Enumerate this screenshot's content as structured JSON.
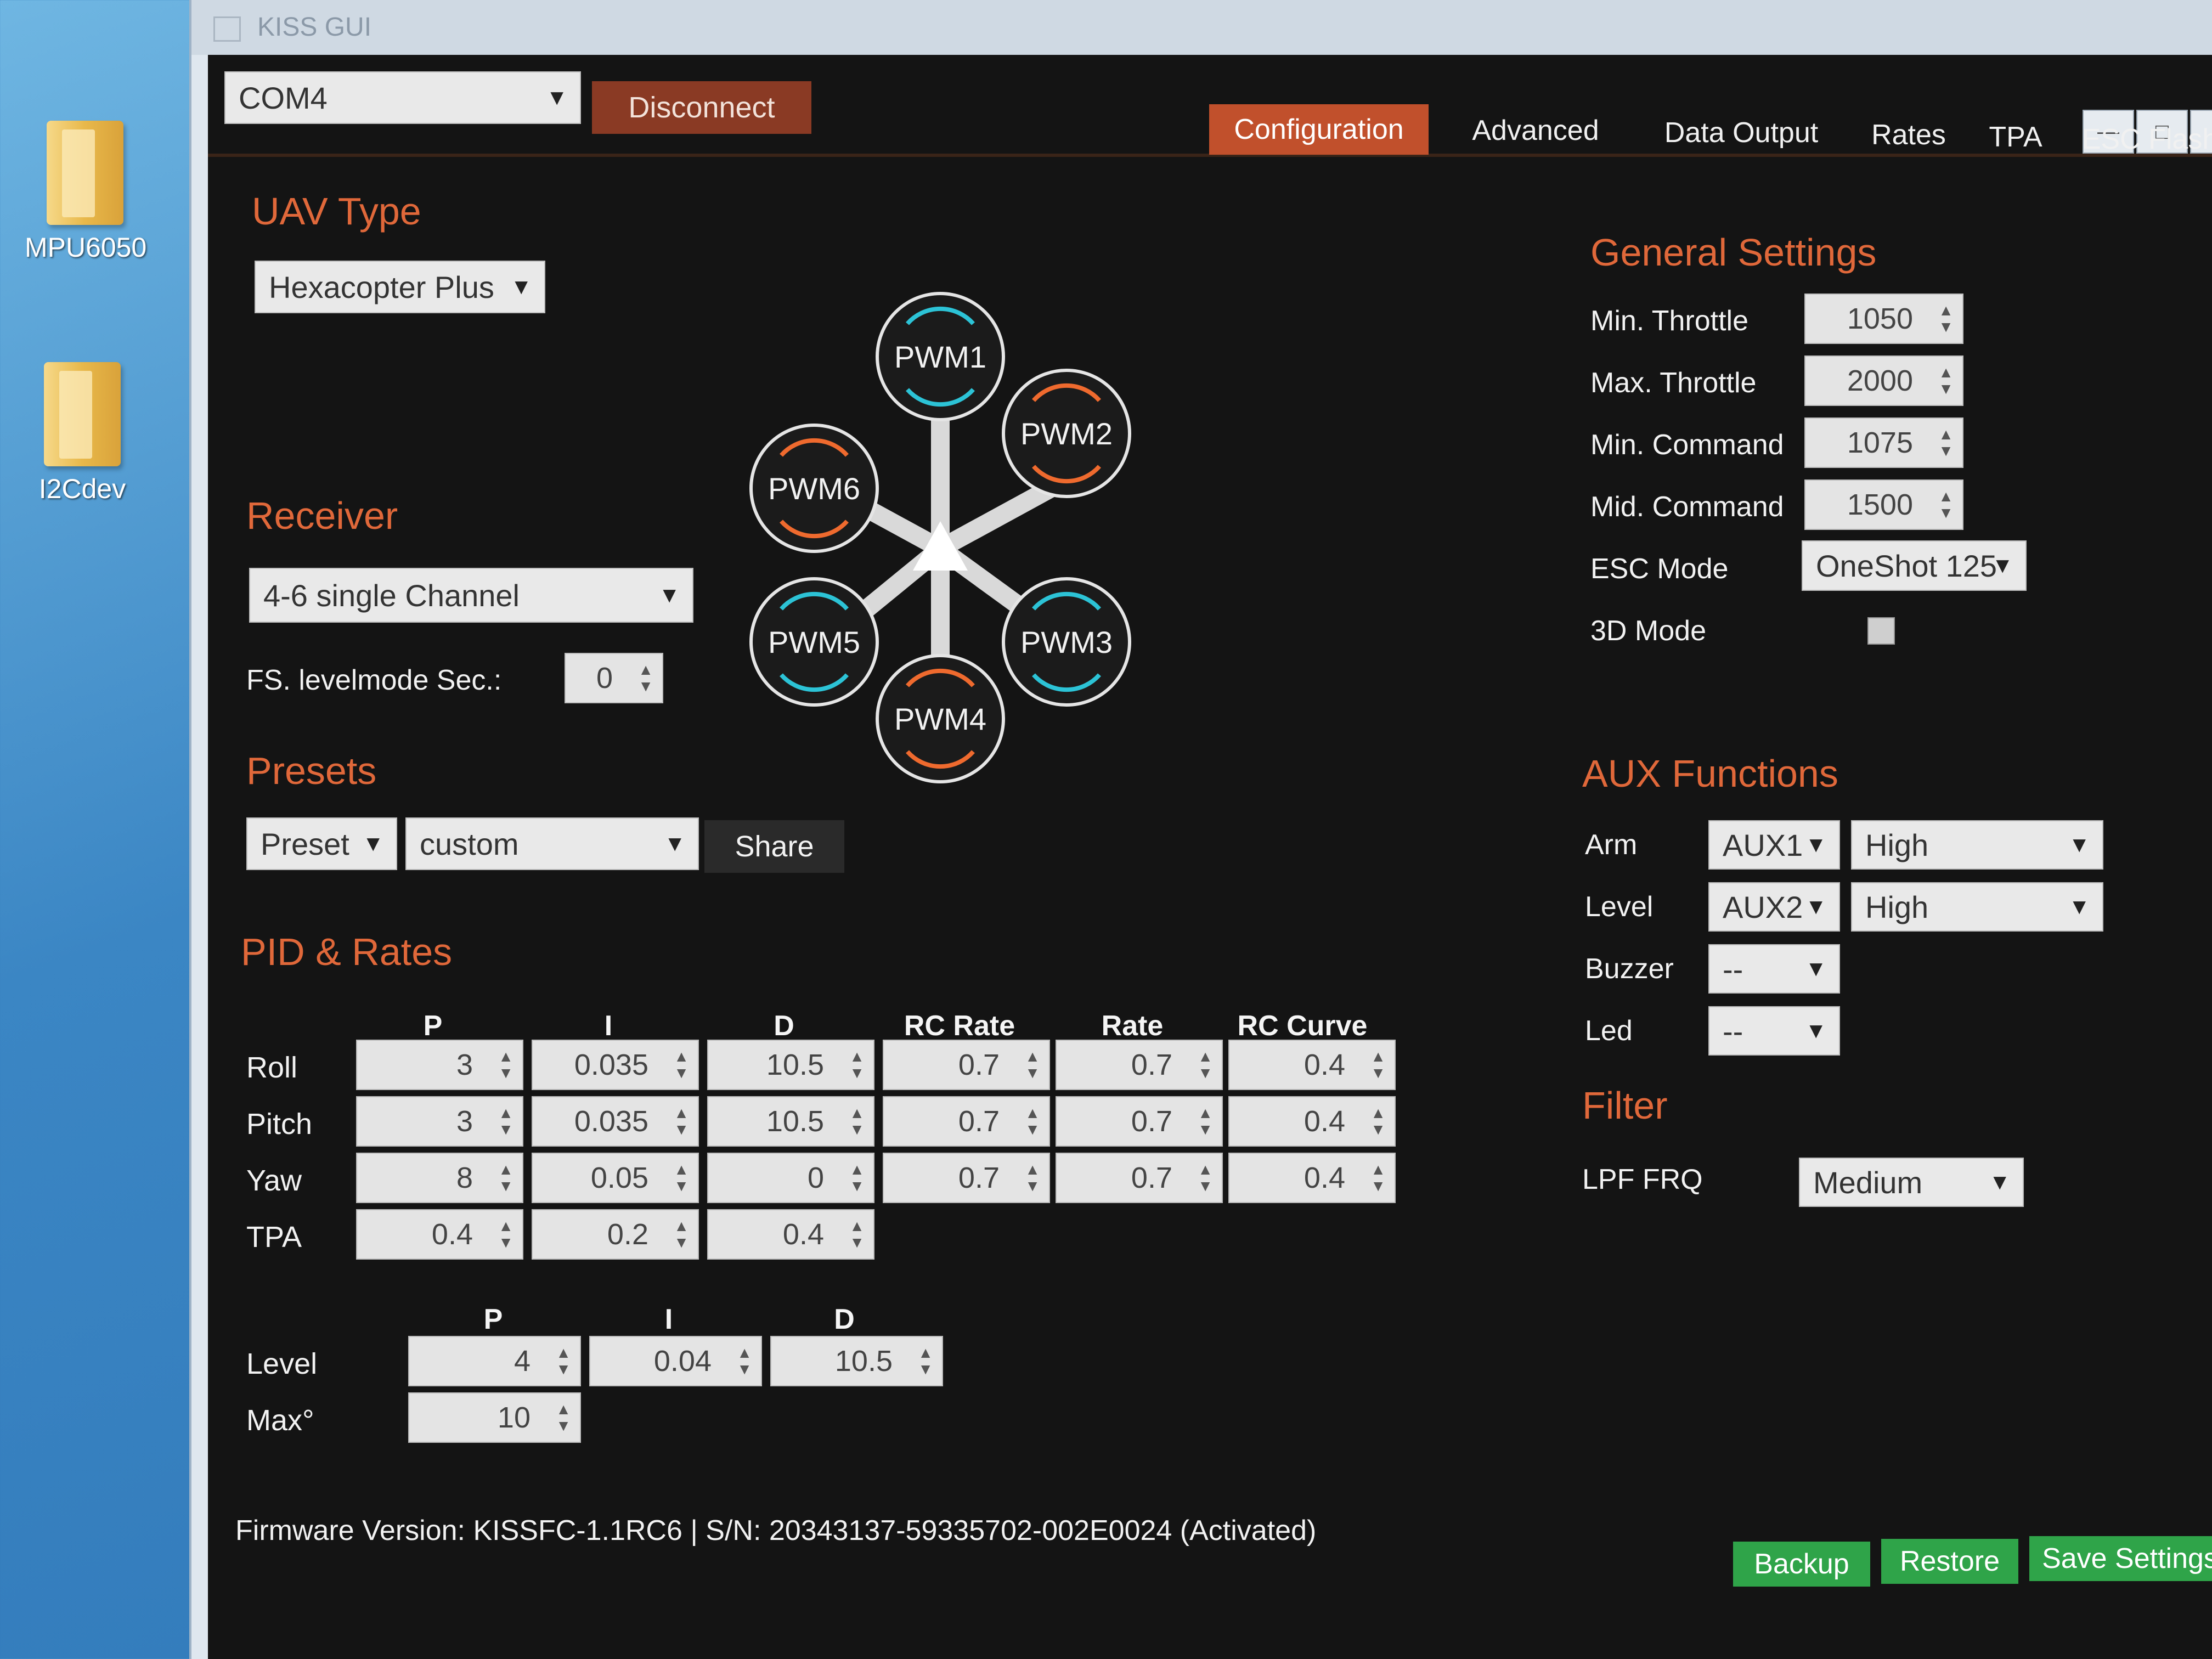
{
  "desktop": {
    "icons": [
      {
        "label": "MPU6050"
      },
      {
        "label": "I2Cdev"
      }
    ]
  },
  "window": {
    "title": "KISS GUI"
  },
  "toolbar": {
    "port": "COM4",
    "disconnect_label": "Disconnect",
    "tabs": [
      {
        "label": "Configuration",
        "active": true
      },
      {
        "label": "Advanced"
      },
      {
        "label": "Data Output"
      },
      {
        "label": "Rates"
      },
      {
        "label": "TPA"
      },
      {
        "label": "ESC Flash"
      }
    ]
  },
  "uav": {
    "title": "UAV Type",
    "selected": "Hexacopter Plus",
    "motors": [
      "PWM1",
      "PWM2",
      "PWM3",
      "PWM4",
      "PWM5",
      "PWM6"
    ]
  },
  "receiver": {
    "title": "Receiver",
    "selected": "4-6 single Channel",
    "fs_label": "FS. levelmode Sec.:",
    "fs_value": "0"
  },
  "presets": {
    "title": "Presets",
    "preset_label": "Preset",
    "preset_value": "custom",
    "share_label": "Share"
  },
  "pid": {
    "title": "PID & Rates",
    "headers": [
      "P",
      "I",
      "D",
      "RC Rate",
      "Rate",
      "RC Curve"
    ],
    "rows": [
      {
        "label": "Roll",
        "values": [
          "3",
          "0.035",
          "10.5",
          "0.7",
          "0.7",
          "0.4"
        ]
      },
      {
        "label": "Pitch",
        "values": [
          "3",
          "0.035",
          "10.5",
          "0.7",
          "0.7",
          "0.4"
        ]
      },
      {
        "label": "Yaw",
        "values": [
          "8",
          "0.05",
          "0",
          "0.7",
          "0.7",
          "0.4"
        ]
      },
      {
        "label": "TPA",
        "values": [
          "0.4",
          "0.2",
          "0.4"
        ]
      }
    ],
    "level_headers": [
      "P",
      "I",
      "D"
    ],
    "level_label": "Level",
    "level_values": [
      "4",
      "0.04",
      "10.5"
    ],
    "max_label": "Max°",
    "max_value": "10"
  },
  "general": {
    "title": "General Settings",
    "fields": [
      {
        "label": "Min. Throttle",
        "value": "1050"
      },
      {
        "label": "Max. Throttle",
        "value": "2000"
      },
      {
        "label": "Min. Command",
        "value": "1075"
      },
      {
        "label": "Mid. Command",
        "value": "1500"
      }
    ],
    "esc_label": "ESC Mode",
    "esc_value": "OneShot 125",
    "mode3d_label": "3D Mode",
    "mode3d_checked": false
  },
  "aux": {
    "title": "AUX Functions",
    "rows": [
      {
        "label": "Arm",
        "channel": "AUX1",
        "state": "High"
      },
      {
        "label": "Level",
        "channel": "AUX2",
        "state": "High"
      },
      {
        "label": "Buzzer",
        "channel": "--"
      },
      {
        "label": "Led",
        "channel": "--"
      }
    ]
  },
  "filter": {
    "title": "Filter",
    "label": "LPF FRQ",
    "value": "Medium"
  },
  "footer": {
    "firmware": "Firmware Version: KISSFC-1.1RC6 | S/N: 20343137-59335702-002E0024 (Activated)",
    "backup_label": "Backup",
    "restore_label": "Restore",
    "save_label": "Save Settings"
  },
  "colors": {
    "accent": "#e0683a",
    "active_tab": "#c1502c",
    "green": "#2fa449",
    "cw": "#ef6a2e",
    "ccw": "#2cc3d6"
  }
}
